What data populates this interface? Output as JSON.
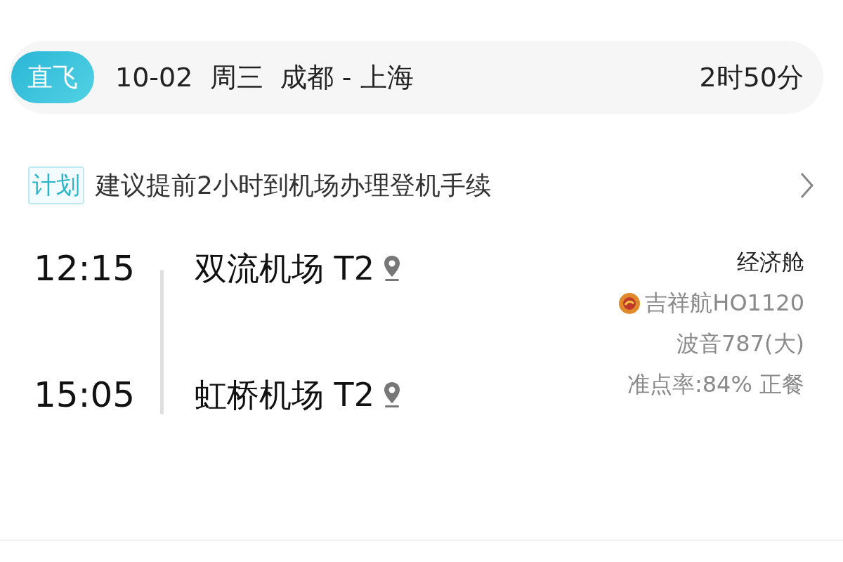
{
  "header": {
    "badge": "直飞",
    "summary": "10-02  周三  成都 - 上海",
    "duration": "2时50分"
  },
  "notice": {
    "tag": "计划",
    "text": "建议提前2小时到机场办理登机手续"
  },
  "segments": [
    {
      "time": "12:15",
      "airport": "双流机场 T2"
    },
    {
      "time": "15:05",
      "airport": "虹桥机场 T2"
    }
  ],
  "details": {
    "cabin": "经济舱",
    "flight": "吉祥航HO1120",
    "aircraft": "波音787(大)",
    "punctuality": "准点率:84% 正餐"
  }
}
